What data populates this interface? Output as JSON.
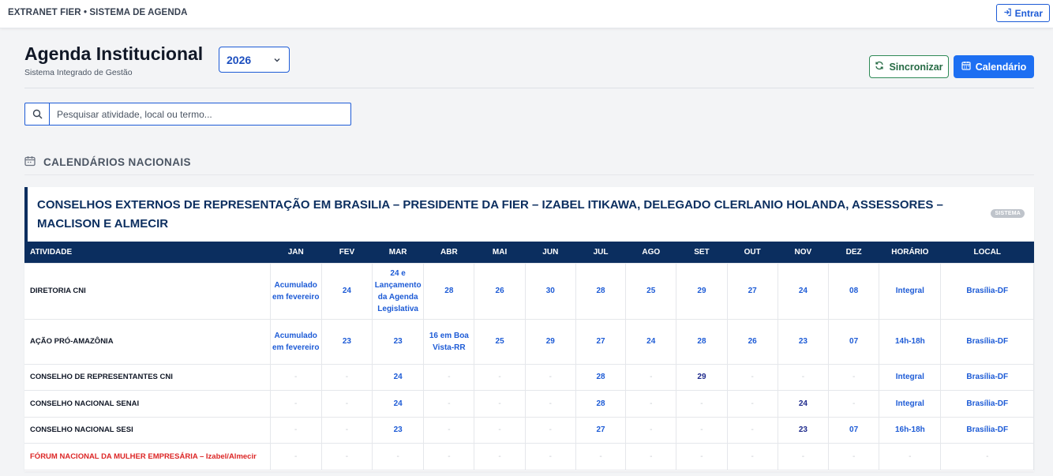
{
  "topbar": {
    "brand": "EXTRANET FIER • SISTEMA DE AGENDA",
    "login_label": "Entrar"
  },
  "header": {
    "title": "Agenda Institucional",
    "subtitle": "Sistema Integrado de Gestão",
    "year": "2026",
    "sync_label": "Sincronizar",
    "calendar_label": "Calendário"
  },
  "search": {
    "placeholder": "Pesquisar atividade, local ou termo..."
  },
  "section": {
    "title": "CALENDÁRIOS NACIONAIS"
  },
  "card": {
    "title": "CONSELHOS EXTERNOS DE REPRESENTAÇÃO EM BRASILIA – PRESIDENTE DA FIER – IZABEL ITIKAWA, DELEGADO CLERLANIO HOLANDA, ASSESSORES – MACLISON E ALMECIR",
    "badge": "SISTEMA"
  },
  "table": {
    "headers": [
      "ATIVIDADE",
      "JAN",
      "FEV",
      "MAR",
      "ABR",
      "MAI",
      "JUN",
      "JUL",
      "AGO",
      "SET",
      "OUT",
      "NOV",
      "DEZ",
      "HORÁRIO",
      "LOCAL"
    ],
    "rows": [
      {
        "cells": [
          "DIRETORIA CNI",
          "Acumulado em fevereiro",
          "24",
          "24 e Lançamento da Agenda Legislativa",
          "28",
          "26",
          "30",
          "28",
          "25",
          "29",
          "27",
          "24",
          "08",
          "Integral",
          "Brasília-DF"
        ]
      },
      {
        "cells": [
          "AÇÃO PRÓ-AMAZÔNIA",
          "Acumulado em fevereiro",
          "23",
          "23",
          "16 em Boa Vista-RR",
          "25",
          "29",
          "27",
          "24",
          "28",
          "26",
          "23",
          "07",
          "14h-18h",
          "Brasília-DF"
        ]
      },
      {
        "cells": [
          "CONSELHO DE REPRESENTANTES CNI",
          "-",
          "-",
          "24",
          "-",
          "-",
          "-",
          "28",
          "-",
          "29",
          "-",
          "-",
          "-",
          "Integral",
          "Brasília-DF"
        ]
      },
      {
        "cells": [
          "CONSELHO NACIONAL SENAI",
          "-",
          "-",
          "24",
          "-",
          "-",
          "-",
          "28",
          "-",
          "-",
          "-",
          "24",
          "-",
          "Integral",
          "Brasília-DF"
        ]
      },
      {
        "cells": [
          "CONSELHO NACIONAL SESI",
          "-",
          "-",
          "23",
          "-",
          "-",
          "-",
          "27",
          "-",
          "-",
          "-",
          "23",
          "07",
          "16h-18h",
          "Brasília-DF"
        ]
      },
      {
        "cells": [
          "FÓRUM NACIONAL DA MULHER EMPRESÁRIA – Izabel/Almecir",
          "-",
          "-",
          "-",
          "-",
          "-",
          "-",
          "-",
          "-",
          "-",
          "-",
          "-",
          "-",
          "-",
          "-"
        ]
      }
    ]
  },
  "colors": {
    "primary": "#1d5bd6",
    "navy": "#0b2e5f",
    "success": "#2f8a57",
    "danger": "#dc2626"
  },
  "icons": {
    "login": "login-icon",
    "chevron": "chevron-down-icon",
    "sync": "sync-icon",
    "calendar": "calendar-icon",
    "search": "search-icon",
    "section": "calendar-icon"
  }
}
